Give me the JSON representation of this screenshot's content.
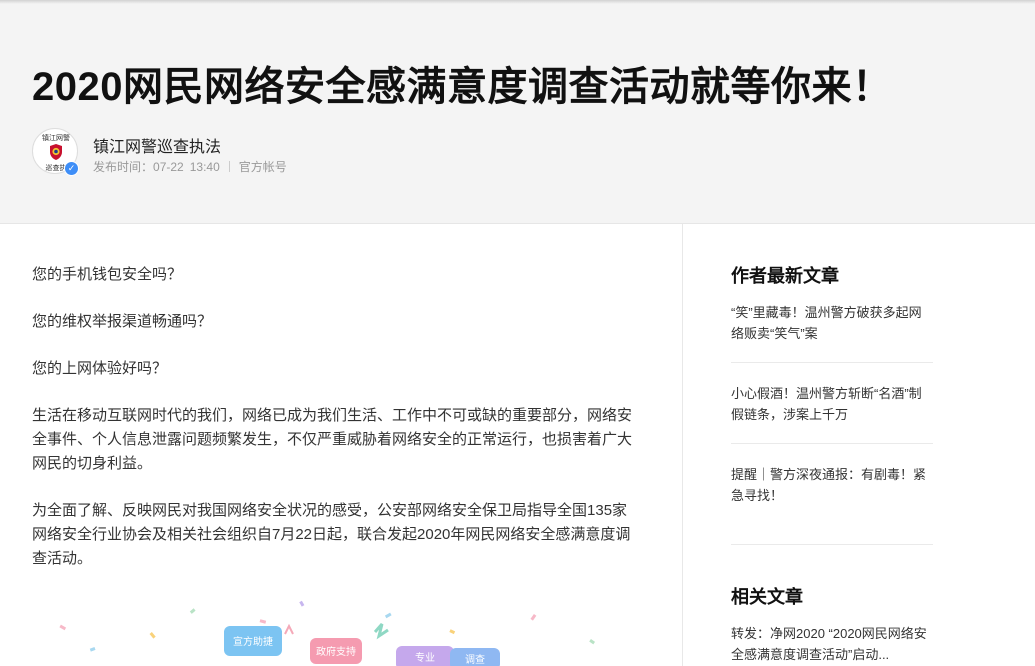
{
  "article": {
    "title": "2020网民网络安全感满意度调查活动就等你来！",
    "author": {
      "name": "镇江网警巡查执法",
      "avatar_text_top": "镇江网警",
      "avatar_text_bottom": "巡查执",
      "time_label": "发布时间：",
      "date": "07-22",
      "time": "13:40",
      "account_type": "官方帐号"
    },
    "paragraphs": [
      "您的手机钱包安全吗？",
      "您的维权举报渠道畅通吗？",
      "您的上网体验好吗？",
      "生活在移动互联网时代的我们，网络已成为我们生活、工作中不可或缺的重要部分，网络安全事件、个人信息泄露问题频繁发生，不仅严重威胁着网络安全的正常运行，也损害着广大网民的切身利益。",
      "为全面了解、反映网民对我国网络安全状况的感受，公安部网络安全保卫局指导全国135家网络安全行业协会及相关社会组织自7月22日起，联合发起2020年网民网络安全感满意度调查活动。"
    ],
    "illustration_tags": [
      "宣方助捷",
      "政府支持",
      "专业",
      "调查"
    ]
  },
  "sidebar": {
    "latest_heading": "作者最新文章",
    "latest": [
      "“笑”里藏毒！温州警方破获多起网络贩卖“笑气”案",
      "小心假酒！温州警方斩断“名酒”制假链条，涉案上千万",
      "提醒｜警方深夜通报：有剧毒！紧急寻找！"
    ],
    "related_heading": "相关文章",
    "related": [
      "转发：净网2020 “2020网民网络安全感满意度调查活动”启动..."
    ]
  },
  "colors": {
    "header_bg": "#f4f4f4",
    "verified": "#3e8ef7"
  }
}
